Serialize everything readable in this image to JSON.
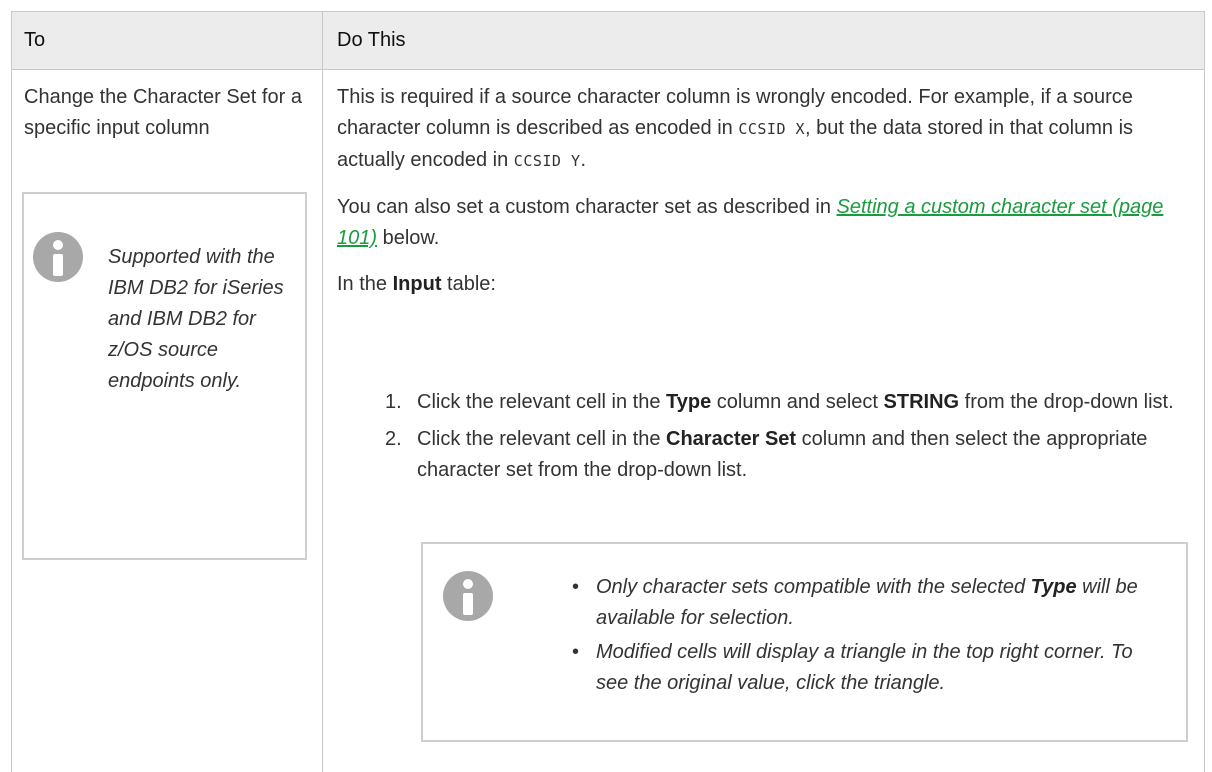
{
  "header": {
    "col_to": "To",
    "col_do": "Do This"
  },
  "row": {
    "to_text": "Change the Character Set for a specific input column",
    "left_note": "Supported with the IBM DB2 for iSeries and IBM DB2 for z/OS source endpoints only.",
    "para1": {
      "a": "This is required if a source character column is wrongly encoded. For example, if a source character column is described as encoded in ",
      "code1": "CCSID X",
      "b": ", but the data stored in that column is actually encoded in ",
      "code2": "CCSID Y",
      "c": "."
    },
    "para2": {
      "a": "You can also set a custom character set as described in ",
      "link": "Setting a custom character set (page 101)",
      "b": " below."
    },
    "para3": {
      "a": "In the ",
      "bold": "Input",
      "b": " table:"
    },
    "steps": [
      {
        "num": "1.",
        "a": "Click the relevant cell in the ",
        "b1": "Type",
        "b": " column and select ",
        "b2": "STRING",
        "c": " from the drop-down list."
      },
      {
        "num": "2.",
        "a": "Click the relevant cell in the ",
        "b1": "Character Set",
        "b": " column and then select the appropriate character set from the drop-down list."
      }
    ],
    "right_note": {
      "bullet": "•",
      "items": [
        {
          "a": "Only character sets compatible with the selected ",
          "bold": "Type",
          "b": " will be available for selection."
        },
        {
          "a": "Modified cells will display a triangle in the top right corner. To see the original value, click the triangle."
        }
      ]
    }
  },
  "colors": {
    "border": "#c8c8c8",
    "header_bg": "#ececec",
    "link": "#1a9c3e",
    "icon": "#a8a8a8"
  },
  "icons": [
    "info-icon"
  ]
}
